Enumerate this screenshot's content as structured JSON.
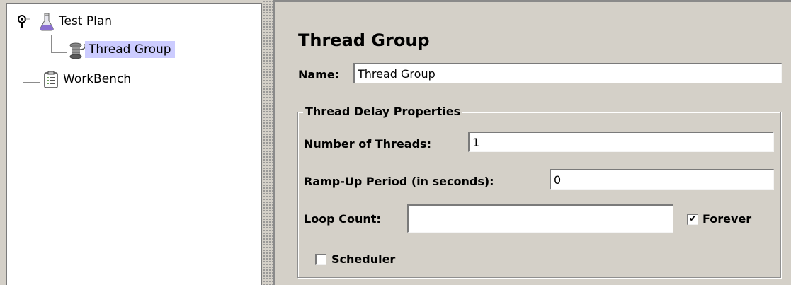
{
  "tree": {
    "nodes": [
      {
        "label": "Test Plan",
        "icon": "flask-icon"
      },
      {
        "label": "Thread Group",
        "icon": "thread-spool-icon",
        "selected": true
      },
      {
        "label": "WorkBench",
        "icon": "clipboard-icon"
      }
    ],
    "root_handle_icon": "pin-icon"
  },
  "panel": {
    "title": "Thread Group",
    "name_label": "Name:",
    "name_value": "Thread Group"
  },
  "properties": {
    "group_title": "Thread Delay Properties",
    "threads_label": "Number of Threads:",
    "threads_value": "1",
    "rampup_label": "Ramp-Up Period (in seconds):",
    "rampup_value": "0",
    "loop_label": "Loop Count:",
    "loop_value": "",
    "forever_label": "Forever",
    "forever_checked": true,
    "scheduler_label": "Scheduler",
    "scheduler_checked": false
  },
  "colors": {
    "background": "#d4d0c8",
    "selection": "#ccccff",
    "tree_background": "#ffffff"
  }
}
